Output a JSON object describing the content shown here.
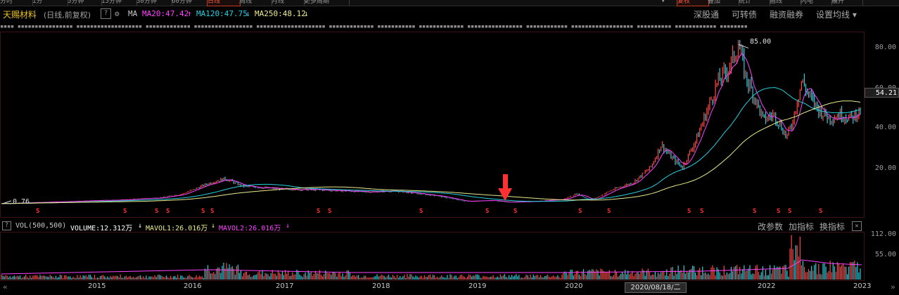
{
  "tabs": [
    {
      "label": "分时",
      "active": false
    },
    {
      "label": "1分",
      "active": false
    },
    {
      "label": "5分钟",
      "active": false
    },
    {
      "label": "15分钟",
      "active": false
    },
    {
      "label": "30分钟",
      "active": false
    },
    {
      "label": "60分钟",
      "active": false
    },
    {
      "label": "日线",
      "active": true
    },
    {
      "label": "周线",
      "active": false
    },
    {
      "label": "月线",
      "active": false
    },
    {
      "label": "更多周期",
      "active": false
    }
  ],
  "right_tabs": [
    "▾",
    "复权",
    "叠加",
    "统计",
    "画线",
    "闪电",
    "展开"
  ],
  "header": {
    "stock_name": "天赐材料",
    "period": "(日线,前复权)",
    "help_icon": "?",
    "ma_label": "MA",
    "ma20": "MA20:47.42",
    "ma20_arrow": "↑",
    "ma120": "MA120:47.75",
    "ma120_arrow": "↓",
    "ma250": "MA250:48.12",
    "ma250_arrow": "↓",
    "links": [
      "深股通",
      "可转债",
      "融资融券",
      "设置均线 ▾"
    ]
  },
  "news_ticker": "▪▪▪▪ ▪▪▪▪▪▪▪▪▪▪▪▪▪▪▪▪ ▪▪▪▪▪▪▪▪▪▪▪▪▪▪▪▪▪▪▪ ▪▪▪▪▪▪▪▪▪▪▪▪▪ ▪▪▪▪▪▪▪▪▪▪▪▪▪▪▪▪▪ ▪▪▪▪▪▪▪▪▪▪▪▪▪▪▪▪▪▪▪▪ ▪▪▪▪▪▪▪▪▪▪▪▪▪ ▪▪▪▪▪▪▪▪▪▪▪ ▪▪▪▪▪▪▪▪▪▪▪▪▪ ▪▪▪▪▪▪▪▪▪▪▪▪▪▪▪▪ ▪▪▪▪▪▪▪▪▪▪▪▪ ▪▪▪▪▪▪▪▪▪▪▪▪▪▪▪▪▪▪ ▪▪▪▪▪▪▪▪▪▪ ▪▪▪▪▪▪▪▪▪▪▪▪ ▪▪▪▪▪▪▪▪",
  "price_axis": [
    "80.00",
    "60.00",
    "40.00",
    "20.00"
  ],
  "current_price": "54.21",
  "max_label": "85.00",
  "min_label": "0.76",
  "volume": {
    "help_icon": "?",
    "title": "VOL(500,500)",
    "volume": "VOLUME:12.312万",
    "volume_arrow": "↓",
    "mavol1": "MAVOL1:26.016万",
    "mavol1_arrow": "↓",
    "mavol2": "MAVOL2:26.016万",
    "mavol2_arrow": "↓",
    "links": [
      "改参数",
      "加指标",
      "换指标"
    ],
    "close_icon": "✕",
    "axis": [
      "112.00",
      "55.00"
    ]
  },
  "x_axis": [
    "2015",
    "2016",
    "2017",
    "2018",
    "2019",
    "2020",
    "2022",
    "2023"
  ],
  "hover_date": "2020/08/18/二",
  "dividend_marker": "S",
  "colors": {
    "ma20": "#ff40ff",
    "ma120": "#26d0e0",
    "ma250": "#ecec8c",
    "up": "#ff4a4a",
    "down": "#26d0e0",
    "accent": "#e8c21c"
  },
  "chart_data": {
    "type": "line",
    "title": "天赐材料 (日线,前复权)",
    "ylim": [
      0,
      90
    ],
    "series": [
      {
        "name": "price",
        "x": [
          "2014",
          "2015",
          "2016",
          "2016.2",
          "2017",
          "2018",
          "2019",
          "2019.3",
          "2020",
          "2020.5",
          "2020.8",
          "2021",
          "2021.5",
          "2021.9",
          "2022.2",
          "2022.3",
          "2022.5",
          "2022.7",
          "2023"
        ],
        "values": [
          0.76,
          1.5,
          3,
          14,
          8,
          7,
          1.5,
          4,
          1,
          10,
          32,
          20,
          70,
          85,
          40,
          48,
          36,
          65,
          50
        ]
      },
      {
        "name": "MA20",
        "last": 47.42
      },
      {
        "name": "MA120",
        "last": 47.75
      },
      {
        "name": "MA250",
        "last": 48.12
      }
    ],
    "volume_ylim": [
      0,
      120
    ],
    "volume_unit": "万"
  }
}
